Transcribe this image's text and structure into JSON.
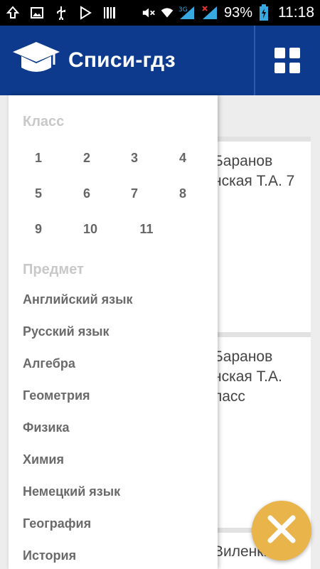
{
  "status_bar": {
    "battery_percent": "93%",
    "time": "11:18",
    "network_label": "3G",
    "icons": [
      "upload-icon",
      "image-icon",
      "usb-icon",
      "play-store-icon",
      "barcode-icon",
      "mute-icon",
      "wifi-icon",
      "signal-icon",
      "signal-no-service-icon",
      "battery-charging-icon"
    ]
  },
  "app_bar": {
    "title": "Списи-гдз",
    "logo_icon": "graduation-cap-icon",
    "menu_icon": "grid-menu-icon",
    "color": "#0d3a8c"
  },
  "drawer": {
    "class_title": "Класс",
    "classes": [
      "1",
      "2",
      "3",
      "4",
      "5",
      "6",
      "7",
      "8",
      "9",
      "10",
      "11"
    ],
    "subject_title": "Предмет",
    "subjects": [
      "Английский язык",
      "Русский язык",
      "Алгебра",
      "Геометрия",
      "Физика",
      "Химия",
      "Немецкий язык",
      "География",
      "История"
    ]
  },
  "background_cards": [
    {
      "line1": "Баранов",
      "line2": "нская Т.А. 7"
    },
    {
      "line1": "Баранов",
      "line2": "нская Т.А.",
      "line3": "ласс"
    },
    {
      "line1": "Виленки"
    }
  ],
  "fab": {
    "icon": "close-icon",
    "color": "#e9b44a"
  }
}
